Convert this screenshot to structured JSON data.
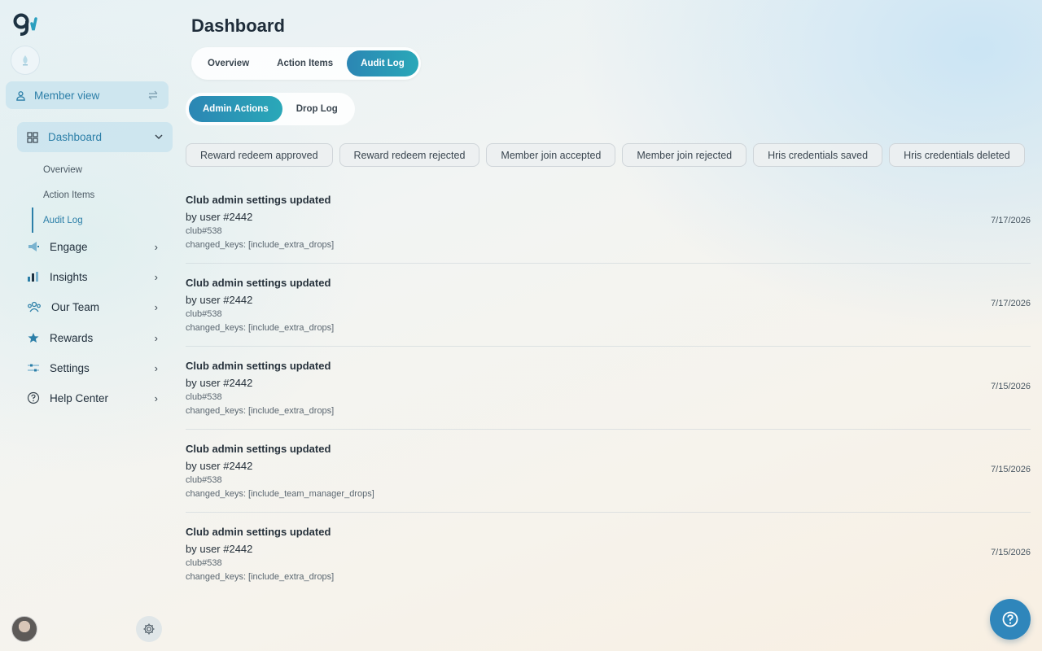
{
  "sidebar": {
    "member_view_label": "Member view",
    "dashboard_label": "Dashboard",
    "dashboard_subitems": [
      "Overview",
      "Action Items",
      "Audit Log"
    ],
    "nav_items": [
      {
        "label": "Engage",
        "icon": "megaphone-icon"
      },
      {
        "label": "Insights",
        "icon": "bar-chart-icon"
      },
      {
        "label": "Our Team",
        "icon": "team-icon"
      },
      {
        "label": "Rewards",
        "icon": "star-icon"
      },
      {
        "label": "Settings",
        "icon": "sliders-icon"
      },
      {
        "label": "Help Center",
        "icon": "question-circle-icon"
      }
    ]
  },
  "header": {
    "title": "Dashboard",
    "tabs": [
      "Overview",
      "Action Items",
      "Audit Log"
    ],
    "active_tab": "Audit Log"
  },
  "subtabs": {
    "items": [
      "Admin Actions",
      "Drop Log"
    ],
    "active": "Admin Actions"
  },
  "filters": [
    "Reward redeem approved",
    "Reward redeem rejected",
    "Member join accepted",
    "Member join rejected",
    "Hris credentials saved",
    "Hris credentials deleted"
  ],
  "log_entries": [
    {
      "title": "Club admin settings updated",
      "user": "by user #2442",
      "club": "club#538",
      "keys": "changed_keys: [include_extra_drops]",
      "date": "7/17/2026"
    },
    {
      "title": "Club admin settings updated",
      "user": "by user #2442",
      "club": "club#538",
      "keys": "changed_keys: [include_extra_drops]",
      "date": "7/17/2026"
    },
    {
      "title": "Club admin settings updated",
      "user": "by user #2442",
      "club": "club#538",
      "keys": "changed_keys: [include_extra_drops]",
      "date": "7/15/2026"
    },
    {
      "title": "Club admin settings updated",
      "user": "by user #2442",
      "club": "club#538",
      "keys": "changed_keys: [include_team_manager_drops]",
      "date": "7/15/2026"
    },
    {
      "title": "Club admin settings updated",
      "user": "by user #2442",
      "club": "club#538",
      "keys": "changed_keys: [include_extra_drops]",
      "date": "7/15/2026"
    }
  ],
  "colors": {
    "accent": "#2c7fa8",
    "active_tab_gradient_start": "#2b86b4",
    "active_tab_gradient_end": "#2aa8b8",
    "help_button": "#2f86bb"
  }
}
